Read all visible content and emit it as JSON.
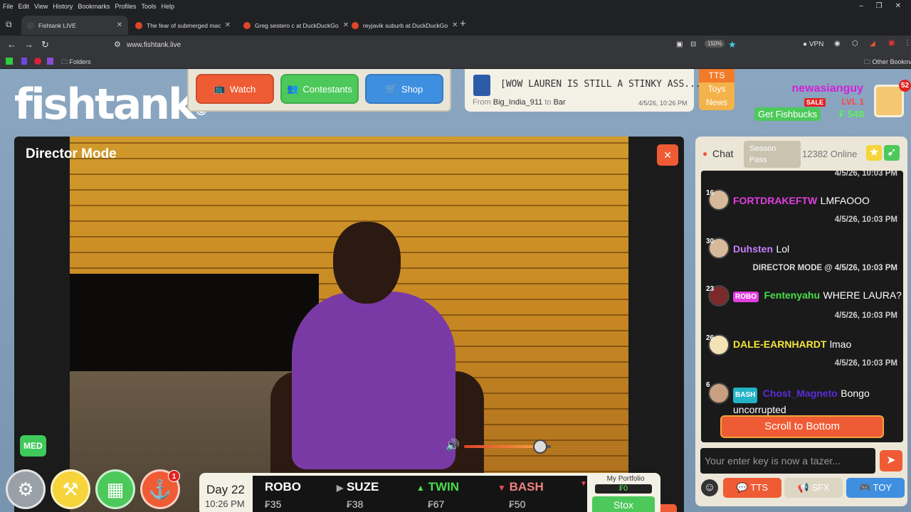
{
  "menu": [
    "File",
    "Edit",
    "View",
    "History",
    "Bookmarks",
    "Profiles",
    "Tools",
    "Help"
  ],
  "tabs": [
    {
      "title": "Fishtank LIVE",
      "active": true
    },
    {
      "title": "The fear of submerged machin",
      "active": false
    },
    {
      "title": "Greg sestero c at DuckDuckGo",
      "active": false
    },
    {
      "title": "reyjavik suburb at DuckDuckGo",
      "active": false
    }
  ],
  "address": {
    "url": "www.fishtank.live",
    "zoom": "150%",
    "vpn": "VPN"
  },
  "bookmarks": {
    "folders": "Folders",
    "other": "Other Bookmarks"
  },
  "site": {
    "logo": "fishtank",
    "logo_mark": "©",
    "nav": {
      "watch": "Watch",
      "contestants": "Contestants",
      "shop": "Shop"
    },
    "ticker": {
      "message": "[WOW LAUREN IS STILL A STINKY ASS...",
      "from_label": "From",
      "from": "Big_India_911",
      "to_label": "to",
      "to": "Bar",
      "time": "4/5/26, 10:26 PM"
    },
    "tts_menu": [
      "TTS",
      "Toys",
      "News"
    ],
    "user": {
      "name": "newasianguy",
      "level": "LVL 1",
      "sale": "SALE",
      "get_fishbucks": "Get Fishbucks",
      "balance": "₣ 548",
      "notifications": "52"
    }
  },
  "video": {
    "title": "Director Mode",
    "quality": "MED",
    "volume": 0.88
  },
  "chat": {
    "title": "Chat",
    "season_pass": "Season Pass",
    "online": "12382 Online",
    "top_time": "4/5/26, 10:03 PM",
    "messages": [
      {
        "level": "16",
        "user": "FORTDRAKEFTW",
        "color": "#e23ee0",
        "text": "LMFAOOO",
        "time": "4/5/26, 10:03 PM"
      },
      {
        "level": "30",
        "user": "Duhsten",
        "color": "#c77dff",
        "text": "Lol",
        "time": "DIRECTOR MODE @ 4/5/26, 10:03 PM"
      },
      {
        "level": "23",
        "badge": "ROBO",
        "user": "Fentenyahu",
        "color": "#4ade4a",
        "text": "WHERE LAURA?",
        "time": "4/5/26, 10:03 PM"
      },
      {
        "level": "26",
        "user": "DALE-EARNHARDT",
        "color": "#f5e63b",
        "text": "lmao",
        "time": "4/5/26, 10:03 PM"
      },
      {
        "level": "6",
        "badge": "BASH",
        "user": "Chost_Magneto",
        "color": "#5b2bd6",
        "text": "Bongo uncorrupted"
      }
    ],
    "scroll_bottom": "Scroll to Bottom",
    "input_placeholder": "Your enter key is now a tazer...",
    "buttons": {
      "tts": "TTS",
      "sfx": "SFX",
      "toy": "TOY"
    }
  },
  "bottom": {
    "day": "Day 22",
    "time": "10:26 PM",
    "alert_count": "1",
    "stocks": [
      {
        "name": "ROBO",
        "price": "₣35",
        "trend": "none"
      },
      {
        "name": "SUZE",
        "price": "₣38",
        "trend": "flat"
      },
      {
        "name": "TWIN",
        "price": "₣67",
        "trend": "up"
      },
      {
        "name": "BASH",
        "price": "₣50",
        "trend": "down"
      }
    ],
    "portfolio": {
      "label": "My Portfolio",
      "value": "₣0",
      "button": "Stox"
    }
  }
}
